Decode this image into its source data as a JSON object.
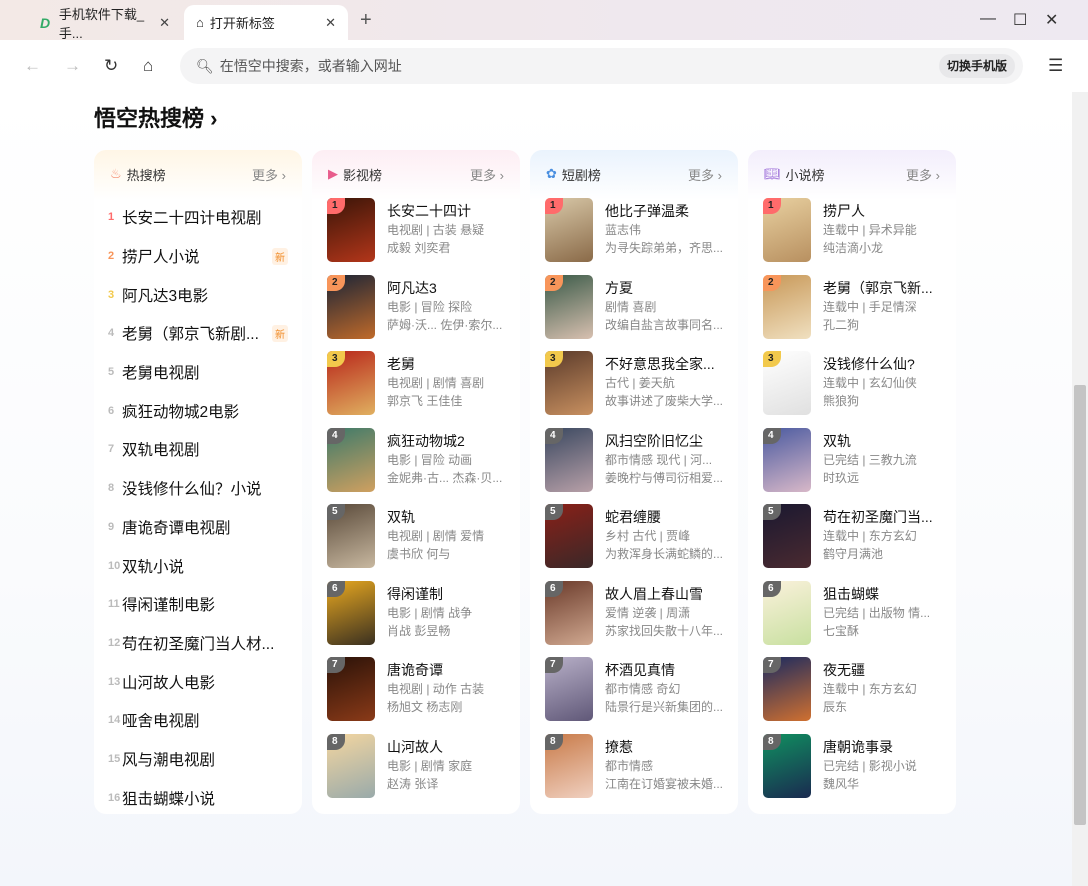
{
  "browser": {
    "tabs": [
      {
        "title": "手机软件下载_手..."
      },
      {
        "title": "打开新标签"
      }
    ],
    "search_placeholder": "在悟空中搜索，或者输入网址",
    "mobile_btn": "切换手机版"
  },
  "page": {
    "title": "悟空热搜榜 ›"
  },
  "colors": {
    "rank1": "#ff6b6b",
    "rank2": "#f8955a",
    "rank3": "#f2cc5a",
    "rankN": "#666666"
  },
  "hot": {
    "label": "热搜榜",
    "more": "更多 ›",
    "items": [
      {
        "rank": "1",
        "title": "长安二十四计电视剧"
      },
      {
        "rank": "2",
        "title": "捞尸人小说",
        "badge": "新"
      },
      {
        "rank": "3",
        "title": "阿凡达3电影"
      },
      {
        "rank": "4",
        "title": "老舅（郭京飞新剧...",
        "badge": "新"
      },
      {
        "rank": "5",
        "title": "老舅电视剧"
      },
      {
        "rank": "6",
        "title": "疯狂动物城2电影"
      },
      {
        "rank": "7",
        "title": "双轨电视剧"
      },
      {
        "rank": "8",
        "title": "没钱修什么仙？小说"
      },
      {
        "rank": "9",
        "title": "唐诡奇谭电视剧"
      },
      {
        "rank": "10",
        "title": "双轨小说"
      },
      {
        "rank": "11",
        "title": "得闲谨制电影"
      },
      {
        "rank": "12",
        "title": "苟在初圣魔门当人材..."
      },
      {
        "rank": "13",
        "title": "山河故人电影"
      },
      {
        "rank": "14",
        "title": "哑舍电视剧"
      },
      {
        "rank": "15",
        "title": "风与潮电视剧"
      },
      {
        "rank": "16",
        "title": "狙击蝴蝶小说"
      }
    ]
  },
  "film": {
    "label": "影视榜",
    "more": "更多 ›",
    "items": [
      {
        "title": "长安二十四计",
        "sub1": "电视剧 | 古装 悬疑",
        "sub2": "成毅 刘奕君"
      },
      {
        "title": "阿凡达3",
        "sub1": "电影 | 冒险 探险",
        "sub2": "萨姆·沃...  佐伊·索尔..."
      },
      {
        "title": "老舅",
        "sub1": "电视剧 | 剧情 喜剧",
        "sub2": "郭京飞 王佳佳"
      },
      {
        "title": "疯狂动物城2",
        "sub1": "电影 | 冒险 动画",
        "sub2": "金妮弗·古...  杰森·贝..."
      },
      {
        "title": "双轨",
        "sub1": "电视剧 | 剧情 爱情",
        "sub2": "虞书欣 何与"
      },
      {
        "title": "得闲谨制",
        "sub1": "电影 | 剧情 战争",
        "sub2": "肖战 彭昱畅"
      },
      {
        "title": "唐诡奇谭",
        "sub1": "电视剧 | 动作 古装",
        "sub2": "杨旭文 杨志刚"
      },
      {
        "title": "山河故人",
        "sub1": "电影 | 剧情 家庭",
        "sub2": "赵涛 张译"
      }
    ]
  },
  "short": {
    "label": "短剧榜",
    "more": "更多 ›",
    "items": [
      {
        "title": "他比子弹温柔",
        "sub1": "蓝志伟",
        "sub2": "为寻失踪弟弟，齐思..."
      },
      {
        "title": "方夏",
        "sub1": "剧情 喜剧",
        "sub2": "改编自盐言故事同名..."
      },
      {
        "title": "不好意思我全家...",
        "sub1": "古代 | 姜天航",
        "sub2": "故事讲述了废柴大学..."
      },
      {
        "title": "风扫空阶旧忆尘",
        "sub1": "都市情感 现代 | 河...",
        "sub2": "姜晚柠与傅司衍相爱..."
      },
      {
        "title": "蛇君缠腰",
        "sub1": "乡村 古代 | 贾峰",
        "sub2": "为救浑身长满蛇鳞的..."
      },
      {
        "title": "故人眉上春山雪",
        "sub1": "爱情 逆袭 | 周潇",
        "sub2": "苏家找回失散十八年..."
      },
      {
        "title": "杯酒见真情",
        "sub1": "都市情感 奇幻",
        "sub2": "陆景行是兴新集团的..."
      },
      {
        "title": "撩惹",
        "sub1": "都市情感",
        "sub2": "江南在订婚宴被未婚..."
      }
    ]
  },
  "novel": {
    "label": "小说榜",
    "more": "更多 ›",
    "items": [
      {
        "title": "捞尸人",
        "sub1": "连载中 | 异术异能",
        "sub2": "纯洁滴小龙"
      },
      {
        "title": "老舅（郭京飞新...",
        "sub1": "连载中 | 手足情深",
        "sub2": "孔二狗"
      },
      {
        "title": "没钱修什么仙?",
        "sub1": "连载中 | 玄幻仙侠",
        "sub2": "熊狼狗"
      },
      {
        "title": "双轨",
        "sub1": "已完结 | 三教九流",
        "sub2": "时玖远"
      },
      {
        "title": "苟在初圣魔门当...",
        "sub1": "连载中 | 东方玄幻",
        "sub2": "鹤守月满池"
      },
      {
        "title": "狙击蝴蝶",
        "sub1": "已完结 | 出版物 情...",
        "sub2": "七宝酥"
      },
      {
        "title": "夜无疆",
        "sub1": "连载中 | 东方玄幻",
        "sub2": "辰东"
      },
      {
        "title": "唐朝诡事录",
        "sub1": "已完结 | 影视小说",
        "sub2": "魏风华"
      }
    ]
  }
}
